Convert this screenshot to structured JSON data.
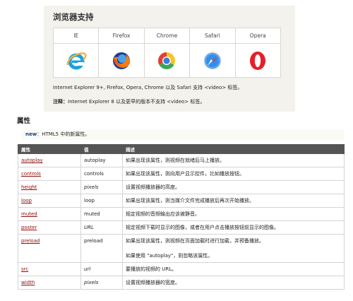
{
  "support": {
    "title": "浏览器支持",
    "browsers": [
      {
        "name": "IE",
        "icon": "ie-icon"
      },
      {
        "name": "Firefox",
        "icon": "firefox-icon"
      },
      {
        "name": "Chrome",
        "icon": "chrome-icon"
      },
      {
        "name": "Safari",
        "icon": "safari-icon"
      },
      {
        "name": "Opera",
        "icon": "opera-icon"
      }
    ],
    "text": "Internet Explorer 9+, Firefox, Opera, Chrome 以及 Safari 支持 <video> 标签。",
    "note_label": "注释：",
    "note_text": "Internet Explorer 8 以及更早的版本不支持 <video> 标签。"
  },
  "attributes": {
    "heading": "属性",
    "new_tag": "new",
    "new_text": "：HTML5 中的新属性。",
    "columns": [
      "属性",
      "值",
      "描述"
    ],
    "rows": [
      {
        "attr": "autoplay",
        "value": "autoplay",
        "desc": "如果出现该属性，则视频在就绪后马上播放。"
      },
      {
        "attr": "controls",
        "value": "controls",
        "desc": "如果出现该属性，则向用户显示控件，比如播放按钮。"
      },
      {
        "attr": "height",
        "value": "pixels",
        "desc": "设置视频播放器的高度。"
      },
      {
        "attr": "loop",
        "value": "loop",
        "desc": "如果出现该属性，则当媒介文件完成播放后再次开始播放。"
      },
      {
        "attr": "muted",
        "value": "muted",
        "desc": "规定视频的音频输出应该被静音。"
      },
      {
        "attr": "poster",
        "value": "URL",
        "desc": "规定视频下载时显示的图像，或者在用户点击播放按钮前显示的图像。"
      },
      {
        "attr": "preload",
        "value": "preload",
        "desc": "如果出现该属性，则视频在页面加载时进行加载，并预备播放。",
        "desc2": "如果使用 \"autoplay\"，则忽略该属性。"
      },
      {
        "attr": "src",
        "value": "url",
        "desc": "要播放的视频的 URL。"
      },
      {
        "attr": "width",
        "value": "pixels",
        "desc": "设置视频播放器的宽度。"
      }
    ]
  },
  "colors": {
    "support_bg": "#f4f2ec",
    "header_bg": "#555555",
    "link": "#900b09",
    "new_tag": "#1a3b9a"
  }
}
